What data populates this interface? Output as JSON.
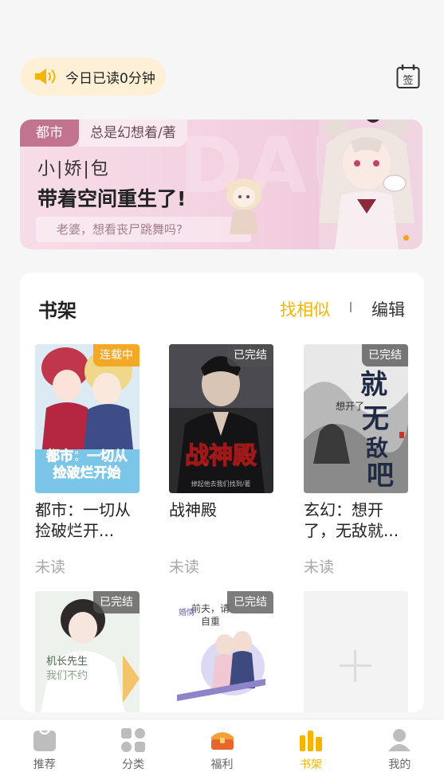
{
  "reading": {
    "today_label": "今日已读0分钟",
    "speaker_icon": "speaker-icon",
    "sign_label": "签"
  },
  "banner": {
    "category": "都市",
    "author": "总是幻想着/著",
    "title_line1": "小|娇|包",
    "title_line2": "带着空间重生了!",
    "subtitle": "老婆，想看丧尸跳舞吗?"
  },
  "shelf": {
    "title": "书架",
    "find_similar": "找相似",
    "edit": "编辑",
    "books": [
      {
        "name": "都市：一切从捡破烂开...",
        "badge": "连载中",
        "status": "未读",
        "cover_text": "都市：一切从捡破烂开始"
      },
      {
        "name": "战神殿",
        "badge": "已完结",
        "status": "未读",
        "cover_text": "战神殿"
      },
      {
        "name": "玄幻：想开了，无敌就...",
        "badge": "已完结",
        "status": "未读",
        "cover_text": "就无敌吧"
      },
      {
        "name": "",
        "badge": "已完结",
        "status": "",
        "cover_text": "机长先生 我们不约"
      },
      {
        "name": "",
        "badge": "已完结",
        "status": "",
        "cover_text": "前夫，请自重 婚情几许"
      }
    ]
  },
  "tabs": [
    {
      "label": "推荐",
      "icon": "recommend-icon"
    },
    {
      "label": "分类",
      "icon": "category-icon"
    },
    {
      "label": "福利",
      "icon": "gift-chest-icon"
    },
    {
      "label": "书架",
      "icon": "bookshelf-icon"
    },
    {
      "label": "我的",
      "icon": "profile-icon"
    }
  ],
  "colors": {
    "accent": "#f4b400",
    "badge_ongoing": "#f3a826",
    "banner_tag": "#c2738f"
  }
}
